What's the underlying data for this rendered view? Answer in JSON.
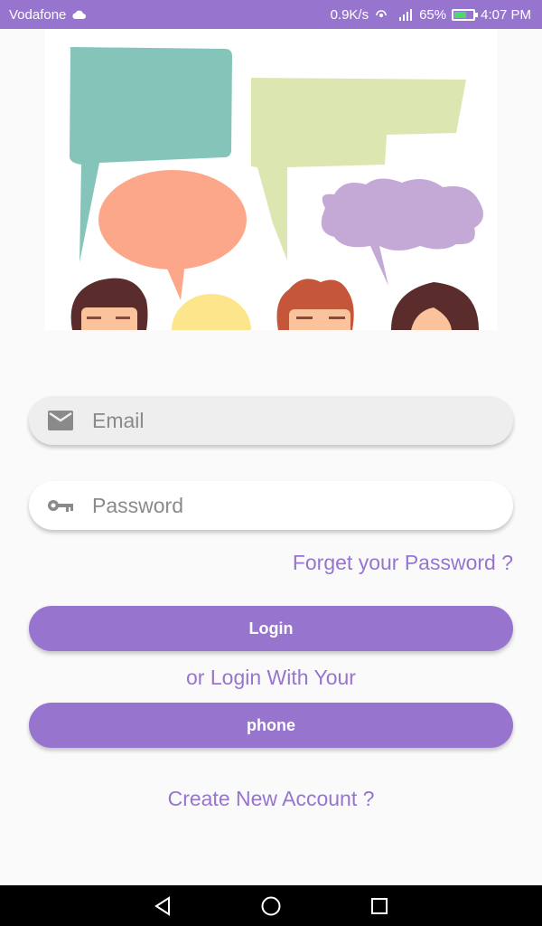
{
  "status_bar": {
    "carrier": "Vodafone",
    "speed": "0.9K/s",
    "battery_percent": "65%",
    "time": "4:07 PM"
  },
  "form": {
    "email_placeholder": "Email",
    "password_placeholder": "Password",
    "forgot_label": "Forget your Password ?",
    "login_label": "Login",
    "or_label": "or Login With Your",
    "phone_label": "phone",
    "create_label": "Create New Account ?"
  },
  "colors": {
    "accent": "#9775cf",
    "background": "#fafafa"
  },
  "icons": {
    "email": "mail-icon",
    "password": "key-icon",
    "nav": [
      "back-icon",
      "home-icon",
      "recents-icon"
    ]
  }
}
